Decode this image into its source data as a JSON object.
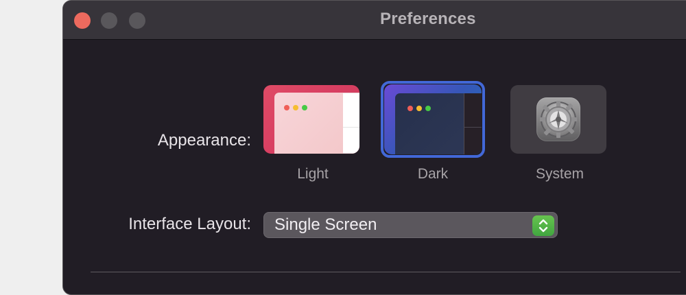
{
  "window": {
    "title": "Preferences",
    "traffic_lights": [
      {
        "name": "close-button",
        "color": "#ed6a5e"
      },
      {
        "name": "minimize-button",
        "color": "#59575b"
      },
      {
        "name": "zoom-button",
        "color": "#59575b"
      }
    ]
  },
  "appearance": {
    "label": "Appearance:",
    "selected": "Dark",
    "options": [
      {
        "label": "Light",
        "selected": false
      },
      {
        "label": "Dark",
        "selected": true
      },
      {
        "label": "System",
        "selected": false
      }
    ]
  },
  "interface_layout": {
    "label": "Interface Layout:",
    "value": "Single Screen"
  },
  "icons": {
    "system": "gear-icon",
    "stepper": "up-down-stepper-icon"
  },
  "colors": {
    "selection": "#4268d8",
    "stepper": "#41a640",
    "close": "#ed6a5e"
  }
}
